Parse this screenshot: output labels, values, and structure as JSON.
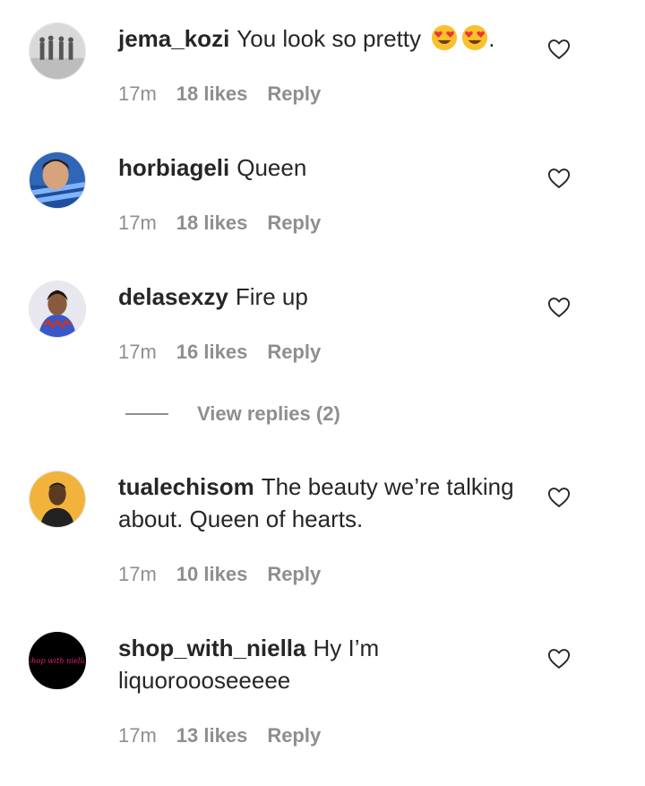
{
  "comments": [
    {
      "username": "jema_kozi",
      "text": "You look so pretty",
      "text_suffix": ".",
      "emojis": [
        "heart-eyes-emoji",
        "heart-eyes-emoji"
      ],
      "time": "17m",
      "likes": "18 likes",
      "reply": "Reply"
    },
    {
      "username": "horbiageli",
      "text": "Queen",
      "time": "17m",
      "likes": "18 likes",
      "reply": "Reply"
    },
    {
      "username": "delasexzy",
      "text": "Fire up",
      "time": "17m",
      "likes": "16 likes",
      "reply": "Reply",
      "view_replies": "View replies (2)"
    },
    {
      "username": "tualechisom",
      "text": "The beauty we’re talking about. Queen of hearts.",
      "time": "17m",
      "likes": "10 likes",
      "reply": "Reply"
    },
    {
      "username": "shop_with_niella",
      "text": "Hy I’m liquoroooseeeee",
      "time": "17m",
      "likes": "13 likes",
      "reply": "Reply",
      "avatar_text": "shop with niella"
    }
  ],
  "colors": {
    "text": "#262626",
    "secondary": "#8e8e8e",
    "avatar_brand_text": "#e0267a"
  },
  "icons": {
    "like": "heart-outline-icon"
  }
}
